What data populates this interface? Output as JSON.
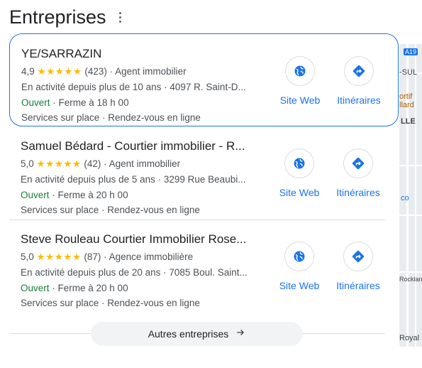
{
  "section": {
    "title": "Entreprises"
  },
  "businesses": [
    {
      "name": "YE/SARRAZIN",
      "rating": "4,9",
      "stars": "★★★★★",
      "reviews": "(423)",
      "category": "Agent immobilier",
      "tenure": "En activité depuis plus de 10 ans",
      "address": "4097 R. Saint-D...",
      "open": "Ouvert",
      "hours": "Ferme à 18 h 00",
      "services": "Services sur place · Rendez-vous en ligne",
      "website_label": "Site Web",
      "directions_label": "Itinéraires"
    },
    {
      "name": "Samuel Bédard - Courtier immobilier - R...",
      "rating": "5,0",
      "stars": "★★★★★",
      "reviews": "(42)",
      "category": "Agent immobilier",
      "tenure": "En activité depuis plus de 5 ans",
      "address": "3299 Rue Beaubi...",
      "open": "Ouvert",
      "hours": "Ferme à 20 h 00",
      "services": "Services sur place · Rendez-vous en ligne",
      "website_label": "Site Web",
      "directions_label": "Itinéraires"
    },
    {
      "name": "Steve Rouleau Courtier Immobilier Rose...",
      "rating": "5,0",
      "stars": "★★★★★",
      "reviews": "(87)",
      "category": "Agence immobilière",
      "tenure": "En activité depuis plus de 20 ans",
      "address": "7085 Boul. Saint...",
      "open": "Ouvert",
      "hours": "Ferme à 20 h 00",
      "services": "Services sur place · Rendez-vous en ligne",
      "website_label": "Site Web",
      "directions_label": "Itinéraires"
    }
  ],
  "more_button": {
    "label": "Autres entreprises"
  },
  "map": {
    "labels": [
      "A19",
      "-SUL",
      "ortif",
      "llard",
      "LLE",
      "co",
      "Rocklan",
      "Royal"
    ]
  },
  "colors": {
    "link": "#1a73e8",
    "open": "#188038",
    "star": "#fbbc04",
    "border_selected": "#1a73e8"
  }
}
